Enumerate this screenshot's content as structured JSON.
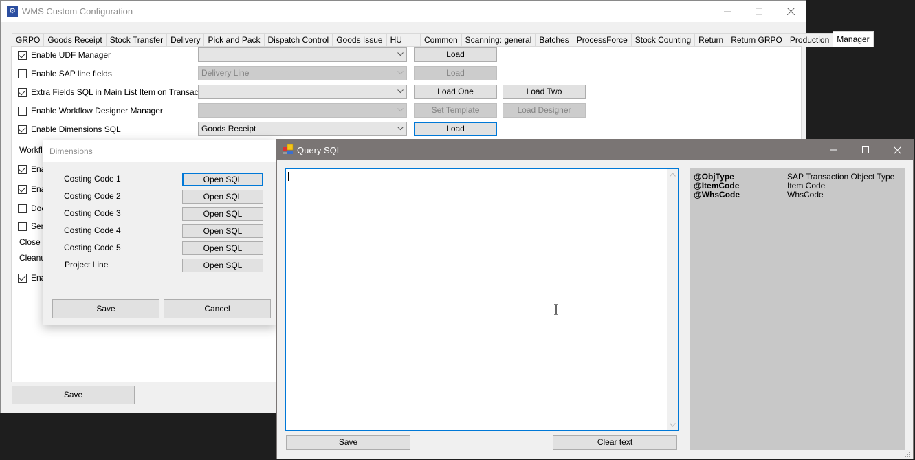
{
  "main_window": {
    "title": "WMS Custom Configuration",
    "app_icon": "gears-icon",
    "tabs": [
      "GRPO",
      "Goods Receipt",
      "Stock Transfer",
      "Delivery",
      "Pick and Pack",
      "Dispatch Control",
      "Goods Issue",
      "HU",
      "Common",
      "Scanning: general",
      "Batches",
      "ProcessForce",
      "Stock Counting",
      "Return",
      "Return GRPO",
      "Production",
      "Manager"
    ],
    "active_tab": "Manager",
    "rows": [
      {
        "label": "Enable UDF Manager",
        "checked": true,
        "combo": "",
        "combo_enabled": true,
        "buttons": [
          {
            "label": "Load",
            "enabled": true
          }
        ]
      },
      {
        "label": "Enable SAP line fields",
        "checked": false,
        "combo": "Delivery Line",
        "combo_enabled": false,
        "buttons": [
          {
            "label": "Load",
            "enabled": false
          }
        ]
      },
      {
        "label": "Extra Fields SQL in Main List Item on Transaction",
        "checked": true,
        "combo": "",
        "combo_enabled": true,
        "buttons": [
          {
            "label": "Load One",
            "enabled": true
          },
          {
            "label": "Load Two",
            "enabled": true
          }
        ]
      },
      {
        "label": "Enable Workflow Designer Manager",
        "checked": false,
        "combo": "",
        "combo_enabled": false,
        "buttons": [
          {
            "label": "Set Template",
            "enabled": false
          },
          {
            "label": "Load Designer",
            "enabled": false
          }
        ]
      },
      {
        "label": "Enable Dimensions SQL",
        "checked": true,
        "combo": "Goods Receipt",
        "combo_enabled": true,
        "buttons": [
          {
            "label": "Load",
            "enabled": true
          }
        ]
      }
    ],
    "partial_rows": [
      {
        "text": "Workflo",
        "type": "label"
      },
      {
        "text": "Ena",
        "type": "checkbox",
        "checked": true
      },
      {
        "text": "Ena",
        "type": "checkbox",
        "checked": true
      },
      {
        "text": "Doc",
        "type": "checkbox",
        "checked": false
      },
      {
        "text": "Sem",
        "type": "checkbox",
        "checked": false
      },
      {
        "text": "Close in",
        "type": "label"
      },
      {
        "text": "Cleanup",
        "type": "label"
      },
      {
        "text": "Ena",
        "type": "checkbox",
        "checked": true
      }
    ],
    "save_label": "Save"
  },
  "dimensions_dialog": {
    "title": "Dimensions",
    "rows": [
      {
        "label": "Costing Code 1",
        "button": "Open SQL"
      },
      {
        "label": "Costing Code 2",
        "button": "Open SQL"
      },
      {
        "label": "Costing Code 3",
        "button": "Open SQL"
      },
      {
        "label": "Costing Code 4",
        "button": "Open SQL"
      },
      {
        "label": "Costing Code 5",
        "button": "Open SQL"
      },
      {
        "label": "Project Line",
        "button": "Open SQL"
      }
    ],
    "save_label": "Save",
    "cancel_label": "Cancel"
  },
  "query_sql_window": {
    "title": "Query SQL",
    "app_icon": "form-icon",
    "editor_value": "",
    "parameters": [
      {
        "name": "@ObjType",
        "description": "SAP Transaction Object Type"
      },
      {
        "name": "@ItemCode",
        "description": "Item Code"
      },
      {
        "name": "@WhsCode",
        "description": "WhsCode"
      }
    ],
    "save_label": "Save",
    "clear_label": "Clear text"
  },
  "colors": {
    "accent": "#0078d7",
    "sql_titlebar": "#7a7574",
    "params_bg": "#c8c8c8",
    "desktop": "#1e1e1e"
  }
}
